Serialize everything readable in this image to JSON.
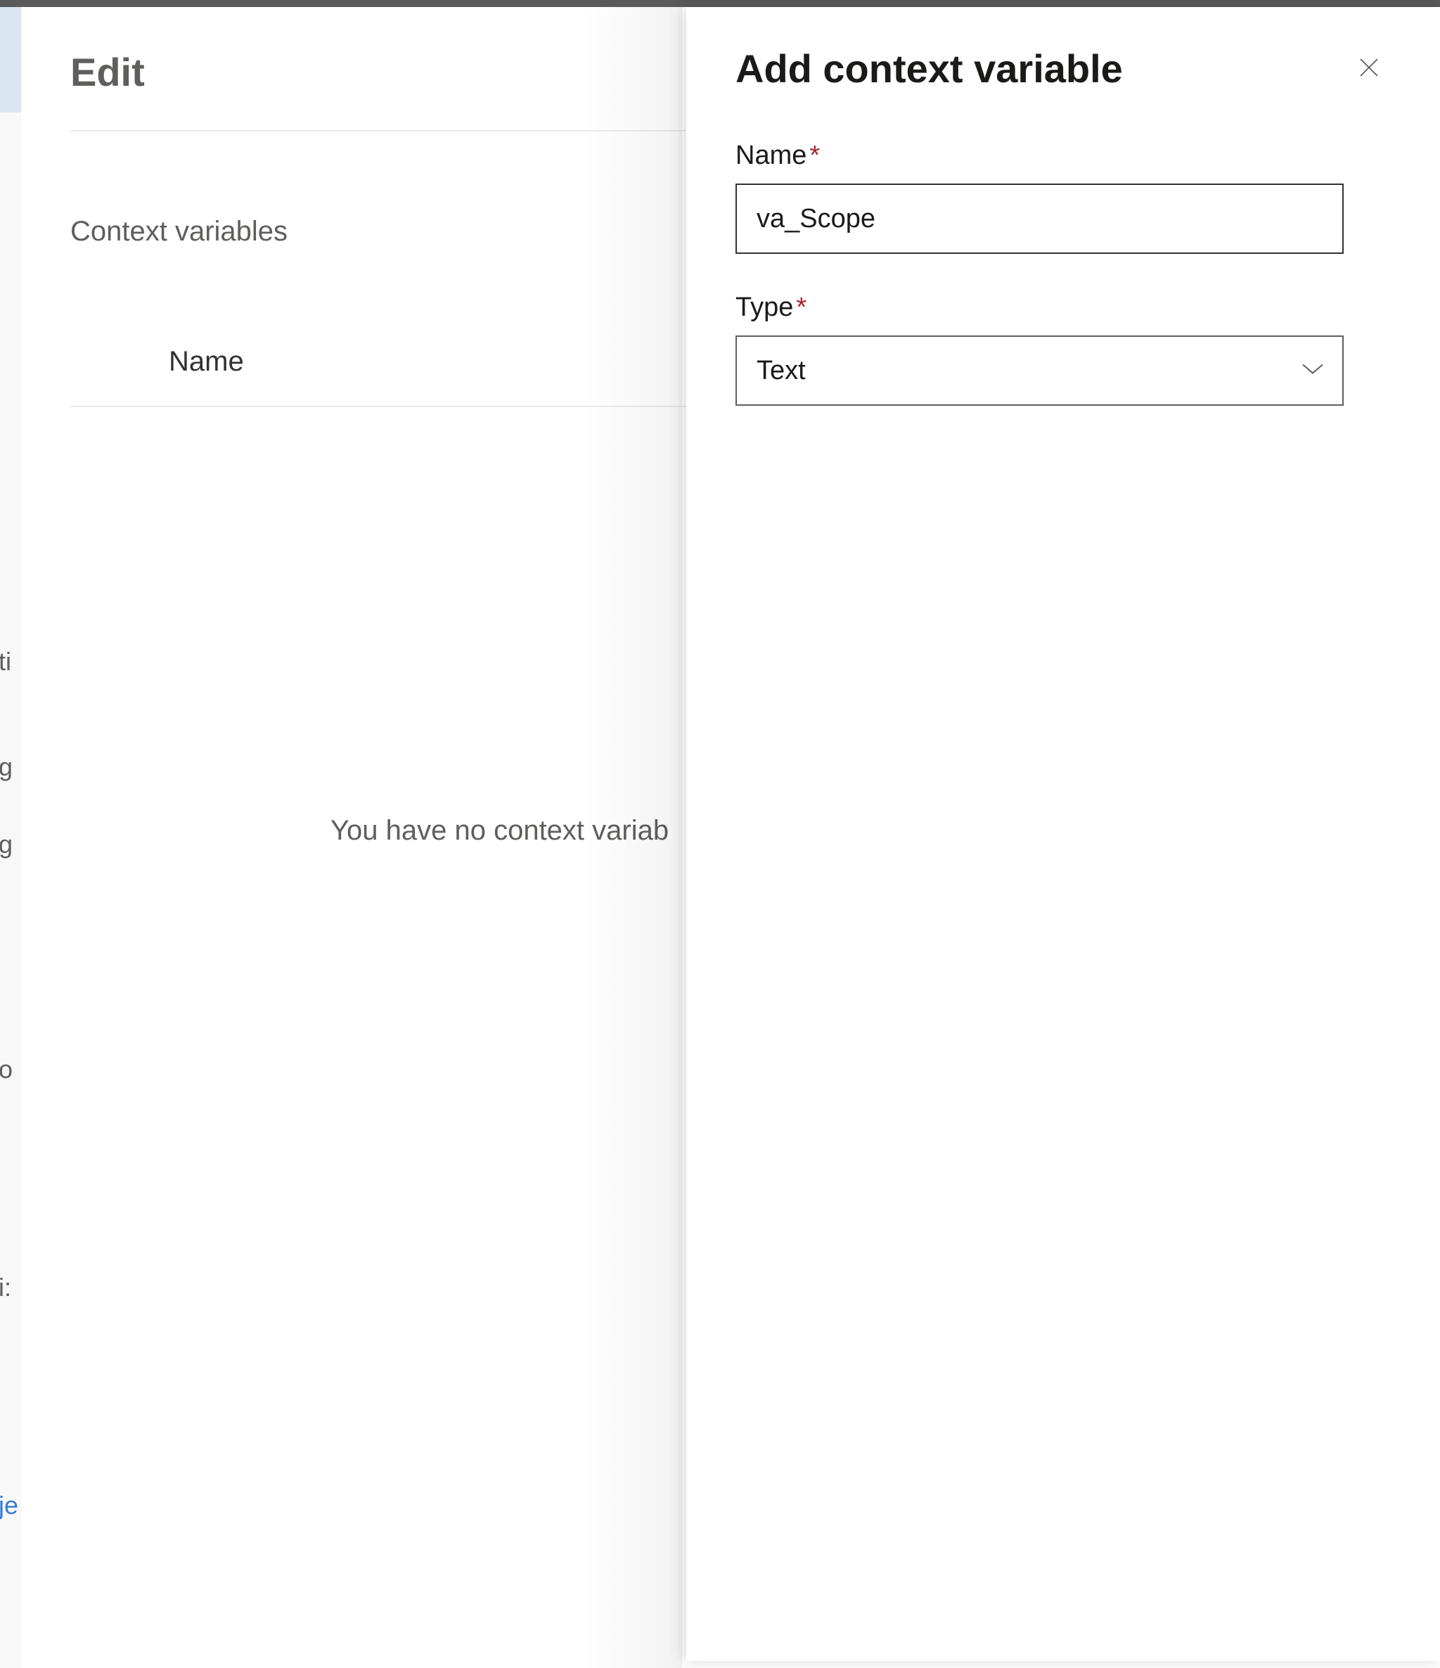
{
  "leftPanel": {
    "title": "Edit",
    "sectionHeading": "Context variables",
    "columnHeader": "Name",
    "emptyState": "You have no context variab"
  },
  "rightPanel": {
    "title": "Add context variable",
    "nameLabel": "Name",
    "nameValue": "va_Scope",
    "typeLabel": "Type",
    "typeValue": "Text",
    "requiredMark": "*"
  },
  "fragments": {
    "f1": "ti",
    "f2": "g",
    "f3": "g",
    "f4": "o",
    "f5": "i:",
    "f6": "je"
  }
}
